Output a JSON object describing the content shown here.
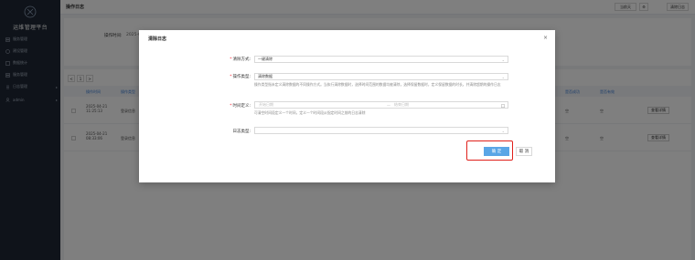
{
  "app": {
    "title": "运维管理平台"
  },
  "sidebar": {
    "items": [
      {
        "label": "服务管理",
        "icon": "server-icon"
      },
      {
        "label": "建设管理",
        "icon": "build-icon"
      },
      {
        "label": "数据统计",
        "icon": "chart-icon"
      },
      {
        "label": "服务管理",
        "icon": "server-icon"
      },
      {
        "label": "日志管理",
        "icon": "log-icon",
        "arrow": "▸"
      },
      {
        "label": "admin",
        "icon": "user-icon",
        "arrow": "▸"
      }
    ]
  },
  "header": {
    "title": "操作日志",
    "buttons": [
      "当前天",
      "⚙",
      "清除日志"
    ]
  },
  "filters": {
    "label": "操作时间:",
    "value": "2025-0"
  },
  "pager": {
    "prev": "<",
    "page": "1",
    "next": ">"
  },
  "table": {
    "headers": [
      "操作时间",
      "操作类型",
      "是否成功",
      "是否有效"
    ],
    "rows": [
      {
        "time": "2025-04-21 11:25:13",
        "type": "登录信息",
        "success": "空",
        "valid": "空",
        "action": "查看详情"
      },
      {
        "time": "2025-04-21 08:33:06",
        "type": "登录信息",
        "success": "空",
        "valid": "空",
        "action": "查看详情"
      }
    ]
  },
  "modal": {
    "title": "清除日志",
    "close": "×",
    "fields": {
      "method": {
        "label": "清除方式:",
        "value": "一键清除"
      },
      "op_type": {
        "label": "操作类型:",
        "value": "清除数据",
        "help": "操作类型指未定义清除数据的不同操作方式。当执行清除数据时，选择时间范围的数据均被清除，选择保留数据时，定义保留数据的时长，并清除超期的操作日志"
      },
      "time": {
        "label": "时间定义:",
        "start_placeholder": "开始日期",
        "sep": "—",
        "end_placeholder": "结束日期",
        "help": "可清空时间段定义一个时间，定义一个时间段从指定时间之前的日志清除"
      },
      "log_type": {
        "label": "日志类型:",
        "value": ""
      }
    },
    "ok": "确 定",
    "cancel": "取 消"
  },
  "colors": {
    "sidebar": "#1e2735",
    "accent": "#5aa6e6",
    "highlight": "#e0201b"
  }
}
